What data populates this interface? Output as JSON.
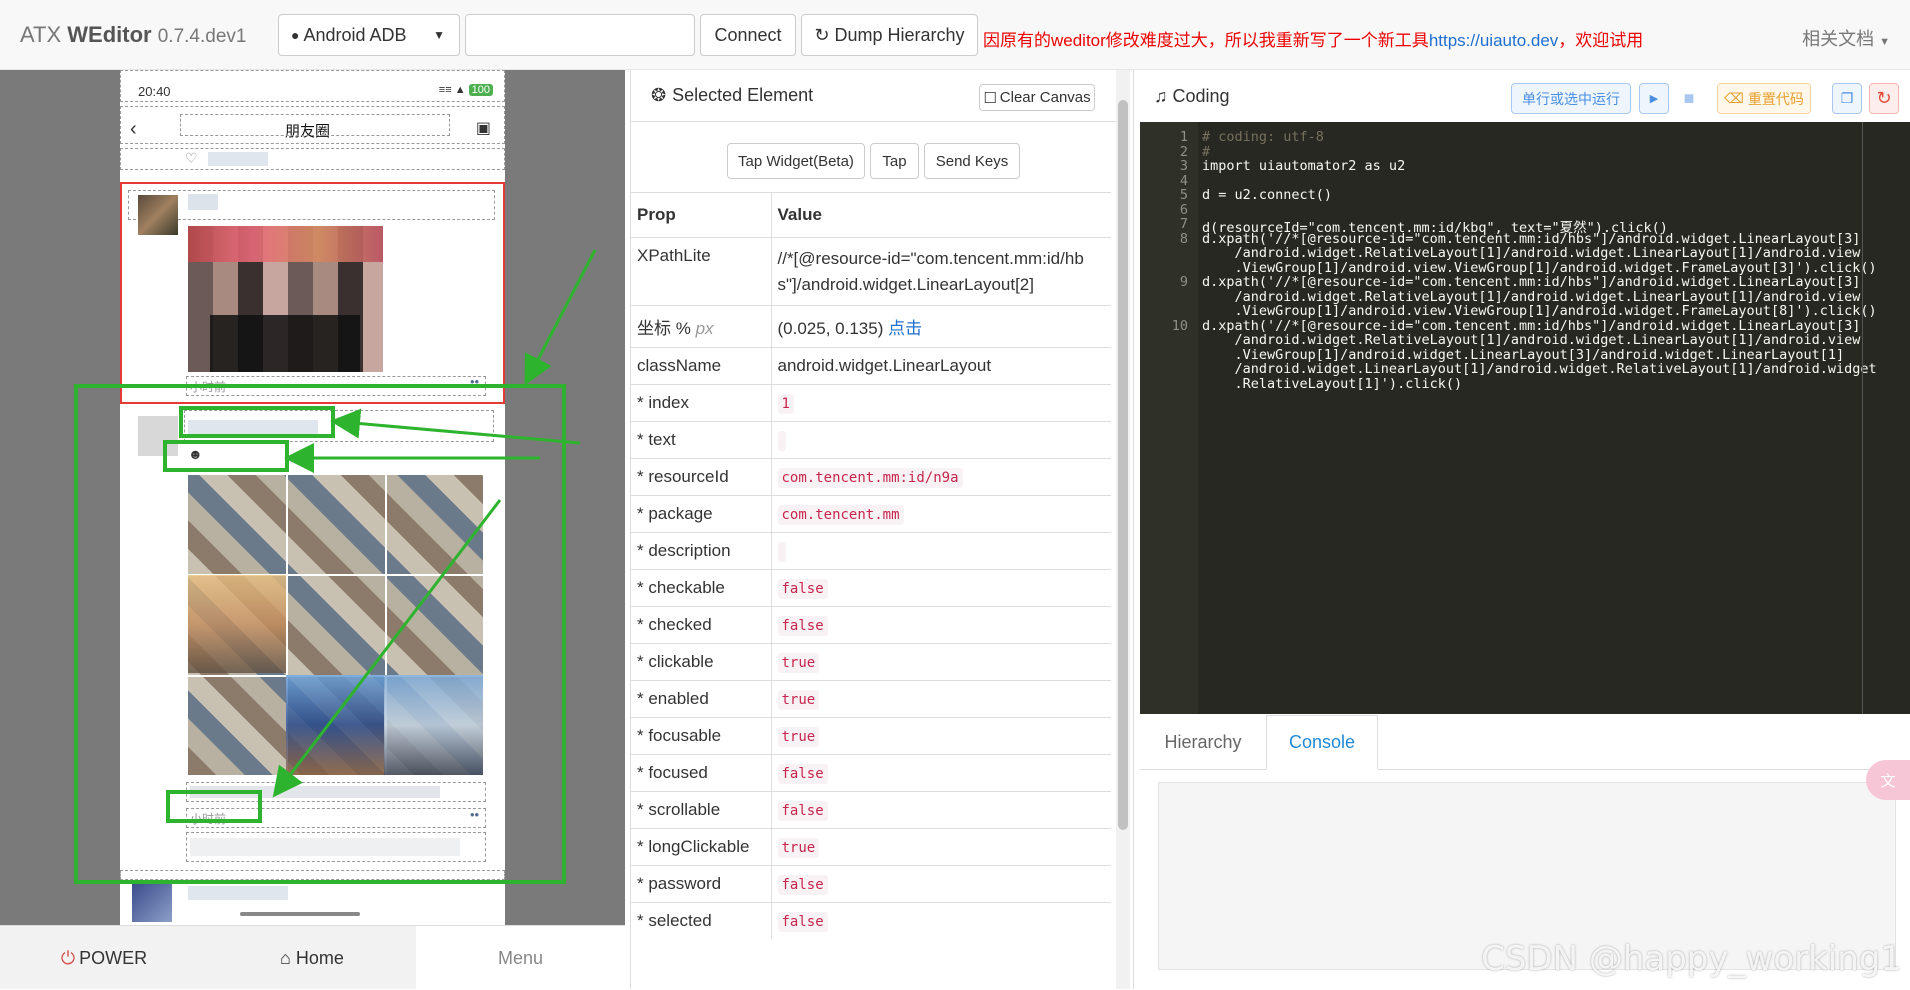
{
  "topbar": {
    "brand_prefix": "ATX",
    "brand_name": "WEditor",
    "brand_version": "0.7.4.dev1",
    "platform_select": "Android ADB",
    "device_input_value": "",
    "connect_label": "Connect",
    "dump_label": "Dump Hierarchy",
    "notice_text": "因原有的weditor修改难度过大，所以我重新写了一个新工具",
    "notice_link": "https://uiauto.dev",
    "notice_suffix": "，欢迎试用",
    "docs_label": "相关文档"
  },
  "phone": {
    "time": "20:40",
    "page_title": "朋友圈",
    "time_ago_1": "小时前",
    "time_ago_2": "小时前"
  },
  "left_bottom": {
    "power_label": "POWER",
    "home_label": "Home",
    "menu_label": "Menu"
  },
  "selected": {
    "title": "Selected Element",
    "clear_label": "Clear Canvas",
    "buttons": [
      "Tap Widget(Beta)",
      "Tap",
      "Send Keys"
    ],
    "col_prop": "Prop",
    "col_value": "Value",
    "xpath_label": "XPathLite",
    "xpath_value": "//*[@resource-id=\"com.tencent.mm:id/hbs\"]/android.widget.LinearLayout[2]",
    "coord_label": "坐标 %",
    "coord_unit": "px",
    "coord_value": "(0.025, 0.135)",
    "coord_link": "点击",
    "classname_label": "className",
    "classname_value": "android.widget.LinearLayout",
    "rows": [
      {
        "k": "* index",
        "v": "1"
      },
      {
        "k": "* text",
        "v": ""
      },
      {
        "k": "* resourceId",
        "v": "com.tencent.mm:id/n9a"
      },
      {
        "k": "* package",
        "v": "com.tencent.mm"
      },
      {
        "k": "* description",
        "v": ""
      },
      {
        "k": "* checkable",
        "v": "false"
      },
      {
        "k": "* checked",
        "v": "false"
      },
      {
        "k": "* clickable",
        "v": "true"
      },
      {
        "k": "* enabled",
        "v": "true"
      },
      {
        "k": "* focusable",
        "v": "true"
      },
      {
        "k": "* focused",
        "v": "false"
      },
      {
        "k": "* scrollable",
        "v": "false"
      },
      {
        "k": "* longClickable",
        "v": "true"
      },
      {
        "k": "* password",
        "v": "false"
      },
      {
        "k": "* selected",
        "v": "false"
      }
    ]
  },
  "coding": {
    "title": "Coding",
    "run_label": "单行或选中运行",
    "reset_label": "重置代码",
    "lines": [
      {
        "n": "1",
        "t": "# coding: utf-8"
      },
      {
        "n": "2",
        "t": "#"
      },
      {
        "n": "3",
        "t": "import uiautomator2 as u2"
      },
      {
        "n": "4",
        "t": ""
      },
      {
        "n": "5",
        "t": "d = u2.connect()"
      },
      {
        "n": "6",
        "t": ""
      },
      {
        "n": "7",
        "t": "d(resourceId=\"com.tencent.mm:id/kbq\", text=\"夏然\").click()"
      },
      {
        "n": "8",
        "t": "d.xpath('//*[@resource-id=\"com.tencent.mm:id/hbs\"]/android.widget.LinearLayout[3]"
      },
      {
        "n": "",
        "t": "    /android.widget.RelativeLayout[1]/android.widget.LinearLayout[1]/android.view"
      },
      {
        "n": "",
        "t": "    .ViewGroup[1]/android.view.ViewGroup[1]/android.widget.FrameLayout[3]').click()"
      },
      {
        "n": "9",
        "t": "d.xpath('//*[@resource-id=\"com.tencent.mm:id/hbs\"]/android.widget.LinearLayout[3]"
      },
      {
        "n": "",
        "t": "    /android.widget.RelativeLayout[1]/android.widget.LinearLayout[1]/android.view"
      },
      {
        "n": "",
        "t": "    .ViewGroup[1]/android.view.ViewGroup[1]/android.widget.FrameLayout[8]').click()"
      },
      {
        "n": "10",
        "t": "d.xpath('//*[@resource-id=\"com.tencent.mm:id/hbs\"]/android.widget.LinearLayout[3]"
      },
      {
        "n": "",
        "t": "    /android.widget.RelativeLayout[1]/android.widget.LinearLayout[1]/android.view"
      },
      {
        "n": "",
        "t": "    .ViewGroup[1]/android.widget.LinearLayout[3]/android.widget.LinearLayout[1]"
      },
      {
        "n": "",
        "t": "    /android.widget.LinearLayout[1]/android.widget.RelativeLayout[1]/android.widget"
      },
      {
        "n": "",
        "t": "    .RelativeLayout[1]').click()"
      }
    ],
    "tab_hierarchy": "Hierarchy",
    "tab_console": "Console"
  },
  "watermark": "CSDN @happy_working1",
  "colors": {
    "highlight_green": "#2db32d",
    "selected_red": "#e53935",
    "link_blue": "#1f6fd1",
    "notice_red": "#e00000"
  }
}
